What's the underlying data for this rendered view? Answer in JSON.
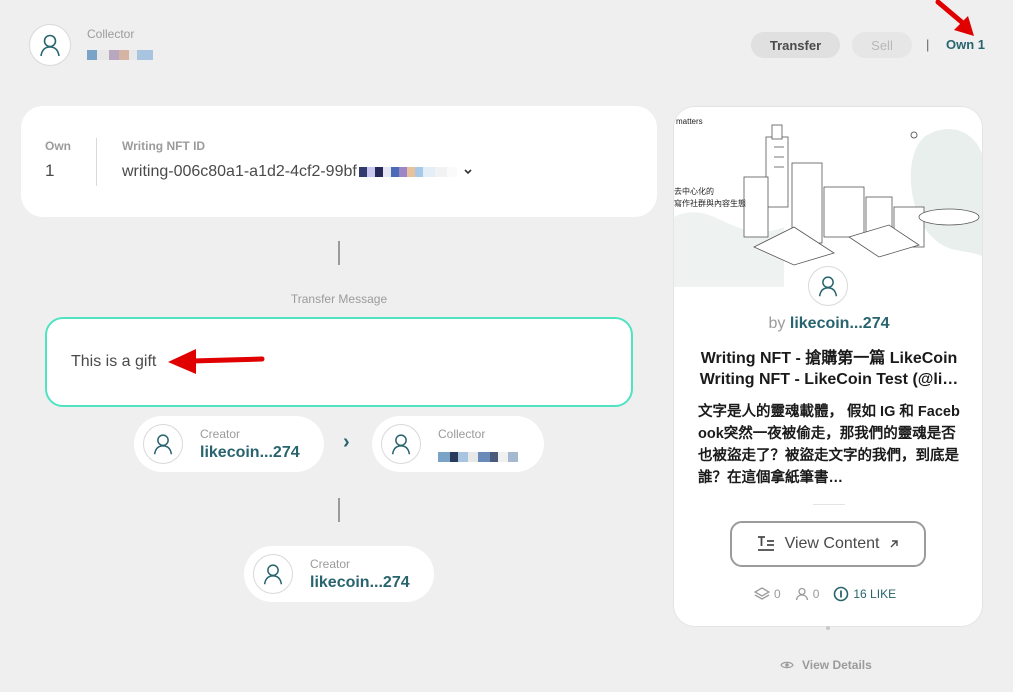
{
  "header": {
    "collector_label": "Collector",
    "transfer_button": "Transfer",
    "sell_button": "Sell",
    "separator": "|",
    "own_link": "Own 1"
  },
  "ownership_card": {
    "own_label": "Own",
    "own_value": "1",
    "nft_id_label": "Writing NFT ID",
    "nft_id_value": "writing-006c80a1-a1d2-4cf2-99bf",
    "dropdown_icon": "chevron-down-icon"
  },
  "transfer": {
    "message_label": "Transfer Message",
    "message_value": "This is a gift",
    "arrow_symbol": "›",
    "from": {
      "caption": "Creator",
      "name": "likecoin...274"
    },
    "to": {
      "caption": "Collector"
    },
    "history": {
      "caption": "Creator",
      "name": "likecoin...274"
    }
  },
  "nft_card": {
    "cover_brand": "matters",
    "cover_text_1": "去中心化的",
    "cover_text_2": "寫作社群與內容生態",
    "by_prefix": "by",
    "author": "likecoin...274",
    "title": "Writing NFT - 搶購第一篇 LikeCoin Writing NFT - LikeCoin Test (@li…",
    "description": "文字是人的靈魂載體， 假如 IG 和 Facebook突然一夜被偷走，那我們的靈魂是否也被盜走了？被盜走文字的我們，到底是誰？在這個拿紙筆書…",
    "view_content_button": "View Content",
    "stats": {
      "layers": "0",
      "collectors": "0",
      "likes": "16 LIKE"
    }
  },
  "view_details_link": "View Details",
  "colors": {
    "brand_teal": "#28646e",
    "accent_mint": "#50e3c2",
    "annotation_red": "#e00000"
  }
}
